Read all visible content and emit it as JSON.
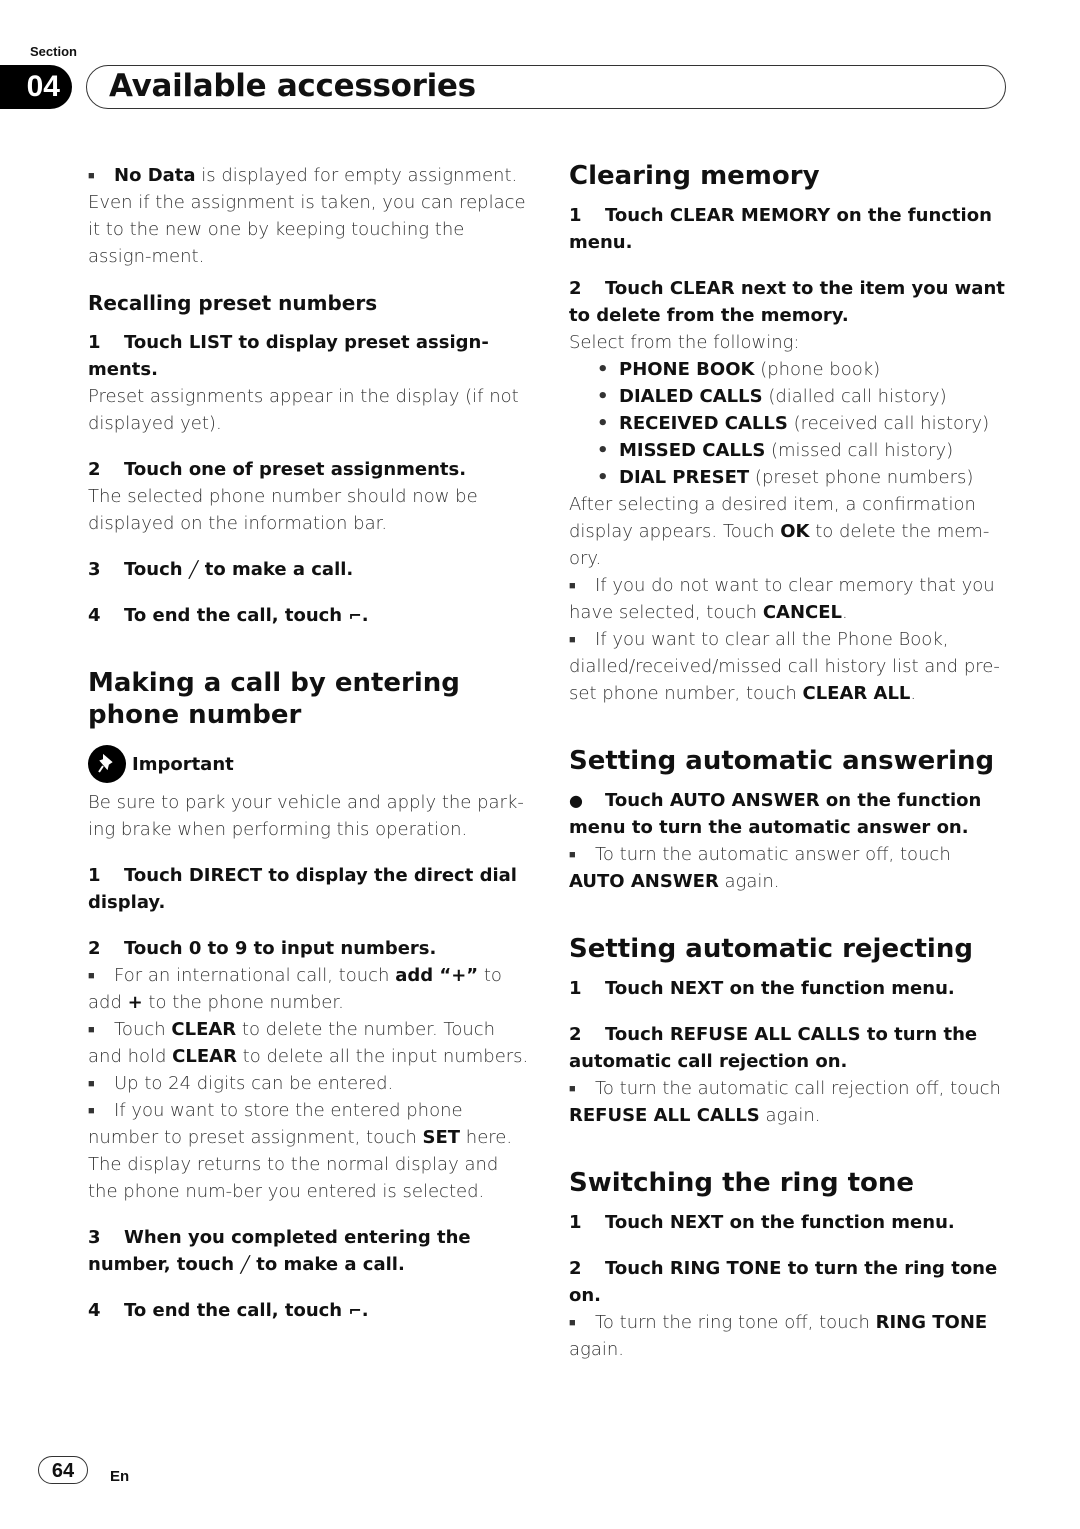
{
  "header": {
    "section_label": "Section",
    "section_number": "04",
    "title": "Available accessories"
  },
  "left": {
    "note_no_data_bold": "No Data",
    "note_no_data": " is displayed for empty assignment. Even if the assignment is taken, you can replace it to the new one by keeping touching the assign-ment.",
    "recall_heading": "Recalling preset numbers",
    "recall_steps": [
      {
        "n": "1",
        "text": "Touch LIST to display preset assign-ments.",
        "desc": "Preset assignments appear in the display (if not displayed yet)."
      },
      {
        "n": "2",
        "text": "Touch one of preset assignments.",
        "desc": "The selected phone number should now be displayed on the information bar."
      },
      {
        "n": "3",
        "pre": "Touch ",
        "post": " to make a call."
      },
      {
        "n": "4",
        "pre": "To end the call, touch ",
        "post": "."
      }
    ],
    "making_heading": "Making a call by entering phone number",
    "important_label": "Important",
    "important_text": "Be sure to park your vehicle and apply the park-ing brake when performing this operation.",
    "making_steps": {
      "s1": {
        "n": "1",
        "text": "Touch DIRECT to display the direct dial display."
      },
      "s2": {
        "n": "2",
        "text": "Touch 0 to 9 to input numbers."
      },
      "notes": {
        "n1a": "For an international call, touch ",
        "n1b": "add “+”",
        "n1c": " to add ",
        "n1d": "+",
        "n1e": " to the phone number.",
        "n2a": "Touch ",
        "n2b": "CLEAR",
        "n2c": " to delete the number. Touch and hold ",
        "n2d": "CLEAR",
        "n2e": " to delete all the input numbers.",
        "n3": "Up to 24 digits can be entered.",
        "n4a": "If you want to store the entered phone number to preset assignment, touch ",
        "n4b": "SET",
        "n4c": " here. The display returns to the normal display and the phone num-ber you entered is selected."
      },
      "s3": {
        "n": "3",
        "pre": "When you completed entering the number, touch ",
        "post": " to make a call."
      },
      "s4": {
        "n": "4",
        "pre": "To end the call, touch ",
        "post": "."
      }
    }
  },
  "right": {
    "clearing_heading": "Clearing memory",
    "c1": {
      "n": "1",
      "text": "Touch CLEAR MEMORY on the function menu."
    },
    "c2": {
      "n": "2",
      "text": "Touch CLEAR next to the item you want to delete from the memory."
    },
    "select_text": "Select from the following:",
    "items": [
      {
        "bold": "PHONE BOOK",
        "desc": " (phone book)"
      },
      {
        "bold": "DIALED CALLS",
        "desc": " (dialled call history)"
      },
      {
        "bold": "RECEIVED CALLS",
        "desc": " (received call history)"
      },
      {
        "bold": "MISSED CALLS",
        "desc": " (missed call history)"
      },
      {
        "bold": "DIAL PRESET",
        "desc": " (preset phone numbers)"
      }
    ],
    "after_a": "After selecting a desired item, a confirmation display appears. Touch ",
    "after_b": "OK",
    "after_c": " to delete the mem-ory.",
    "cn1a": "If you do not want to clear memory that you have selected, touch ",
    "cn1b": "CANCEL",
    "cn1c": ".",
    "cn2a": "If you want to clear all the Phone Book, dialled/received/missed call history list and pre-set phone number, touch ",
    "cn2b": "CLEAR ALL",
    "cn2c": ".",
    "auto_answer_heading": "Setting automatic answering",
    "aa_step": "Touch AUTO ANSWER on the function menu to turn the automatic answer on.",
    "aa_note_a": "To turn the automatic answer off, touch ",
    "aa_note_b": "AUTO ANSWER",
    "aa_note_c": " again.",
    "reject_heading": "Setting automatic rejecting",
    "r1": {
      "n": "1",
      "text": "Touch NEXT on the function menu."
    },
    "r2": {
      "n": "2",
      "text": "Touch REFUSE ALL CALLS to turn the automatic call rejection on."
    },
    "r_note_a": "To turn the automatic call rejection off, touch ",
    "r_note_b": "REFUSE ALL CALLS",
    "r_note_c": " again.",
    "ring_heading": "Switching the ring tone",
    "t1": {
      "n": "1",
      "text": "Touch NEXT on the function menu."
    },
    "t2": {
      "n": "2",
      "text": "Touch RING TONE to turn the ring tone on."
    },
    "t_note_a": "To turn the ring tone off, touch ",
    "t_note_b": "RING TONE",
    "t_note_c": " again."
  },
  "footer": {
    "page": "64",
    "lang": "En"
  },
  "icons": {
    "call": "╱",
    "end": "⌐"
  }
}
